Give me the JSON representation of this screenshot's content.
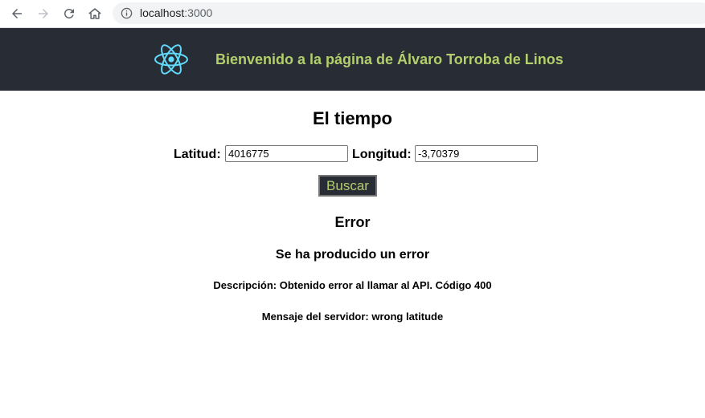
{
  "browser": {
    "url_host": "localhost",
    "url_port": ":3000",
    "icons": [
      "back-arrow-icon",
      "forward-arrow-icon",
      "reload-icon",
      "home-icon",
      "info-icon"
    ]
  },
  "header": {
    "title": "Bienvenido a la página de Álvaro Torroba de Linos",
    "logo_icon": "react-logo-icon",
    "background_color": "#282c34",
    "accent_color": "#b2cf6c",
    "logo_color": "#61dafb"
  },
  "main": {
    "title": "El tiempo",
    "latitude_label": "Latitud:",
    "latitude_value": "4016775",
    "longitude_label": "Longitud:",
    "longitude_value": "-3,70379",
    "search_label": "Buscar"
  },
  "error": {
    "title": "Error",
    "subtitle": "Se ha producido un error",
    "description": "Descripción: Obtenido error al llamar al API. Código 400",
    "server_message": "Mensaje del servidor: wrong latitude"
  }
}
